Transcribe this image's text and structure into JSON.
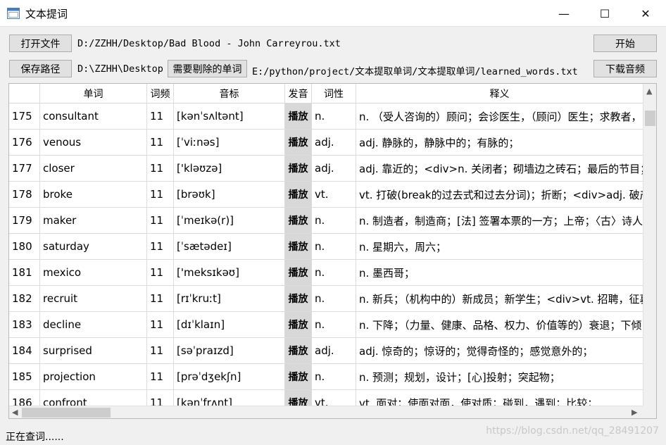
{
  "window": {
    "title": "文本提词",
    "minimize_glyph": "—",
    "maximize_glyph": "☐",
    "close_glyph": "✕"
  },
  "toolbar": {
    "open_file_label": "打开文件",
    "file_path": "D:/ZZHH/Desktop/Bad Blood - John Carreyrou.txt",
    "start_label": "开始",
    "save_path_label": "保存路径",
    "save_path": "D:\\ZZHH\\Desktop",
    "exclude_label": "需要剔除的单词",
    "exclude_path": "E:/python/project/文本提取单词/文本提取单词/learned_words.txt",
    "download_label": "下载音频"
  },
  "table": {
    "headers": [
      "单词",
      "词频",
      "音标",
      "发音",
      "词性",
      "释义"
    ],
    "rows": [
      {
        "num": "175",
        "word": "consultant",
        "freq": "11",
        "phonetic": "[kənˈsʌltənt]",
        "play": "播放",
        "pos": "n.",
        "def": "n. （受人咨询的）顾问；会诊医生，（顾问）医生；求教者，"
      },
      {
        "num": "176",
        "word": "venous",
        "freq": "11",
        "phonetic": "[ˈviːnəs]",
        "play": "播放",
        "pos": "adj.",
        "def": "adj. 静脉的，静脉中的；有脉的；"
      },
      {
        "num": "177",
        "word": "closer",
        "freq": "11",
        "phonetic": "['kləʊzə]",
        "play": "播放",
        "pos": "adj.",
        "def": "adj. 靠近的；<div>n. 关闭者；砌墙边之砖石；最后的节目；"
      },
      {
        "num": "178",
        "word": "broke",
        "freq": "11",
        "phonetic": "[brəʊk]",
        "play": "播放",
        "pos": "vt.",
        "def": "vt. 打破(break的过去式和过去分词)；折断；<div>adj. 破产"
      },
      {
        "num": "179",
        "word": "maker",
        "freq": "11",
        "phonetic": "[ˈmeɪkə(r)]",
        "play": "播放",
        "pos": "n.",
        "def": "n. 制造者，制造商；[法] 签署本票的一方；上帝；〈古〉诗人"
      },
      {
        "num": "180",
        "word": "saturday",
        "freq": "11",
        "phonetic": "[ˈsætədeɪ]",
        "play": "播放",
        "pos": "n.",
        "def": "n. 星期六，周六；"
      },
      {
        "num": "181",
        "word": "mexico",
        "freq": "11",
        "phonetic": "['meksɪkəʊ]",
        "play": "播放",
        "pos": "n.",
        "def": "n. 墨西哥；"
      },
      {
        "num": "182",
        "word": "recruit",
        "freq": "11",
        "phonetic": "[rɪˈkruːt]",
        "play": "播放",
        "pos": "n.",
        "def": "n. 新兵；（机构中的）新成员；新学生；<div>vt. 招聘，征募"
      },
      {
        "num": "183",
        "word": "decline",
        "freq": "11",
        "phonetic": "[dɪˈklaɪn]",
        "play": "播放",
        "pos": "n.",
        "def": "n. 下降；（力量、健康、品格、权力、价值等的）衰退；下倾"
      },
      {
        "num": "184",
        "word": "surprised",
        "freq": "11",
        "phonetic": "[səˈpraɪzd]",
        "play": "播放",
        "pos": "adj.",
        "def": "adj. 惊奇的；惊讶的；觉得奇怪的；感觉意外的；"
      },
      {
        "num": "185",
        "word": "projection",
        "freq": "11",
        "phonetic": "[prəˈdʒekʃn]",
        "play": "播放",
        "pos": "n.",
        "def": "n. 预测；规划，设计；[心]投射；突起物；"
      },
      {
        "num": "186",
        "word": "confront",
        "freq": "11",
        "phonetic": "[kənˈfrʌnt]",
        "play": "播放",
        "pos": "vt.",
        "def": "vt. 面对；使面对面，使对质；碰到，遇到；比较；"
      }
    ]
  },
  "status": {
    "text": "正在查词......",
    "watermark": "https://blog.csdn.net/qq_28491207"
  },
  "colors": {
    "button_bg": "#e1e1e1",
    "play_cell_bg": "#d8d8d8",
    "window_bg": "#f0f0f0"
  }
}
